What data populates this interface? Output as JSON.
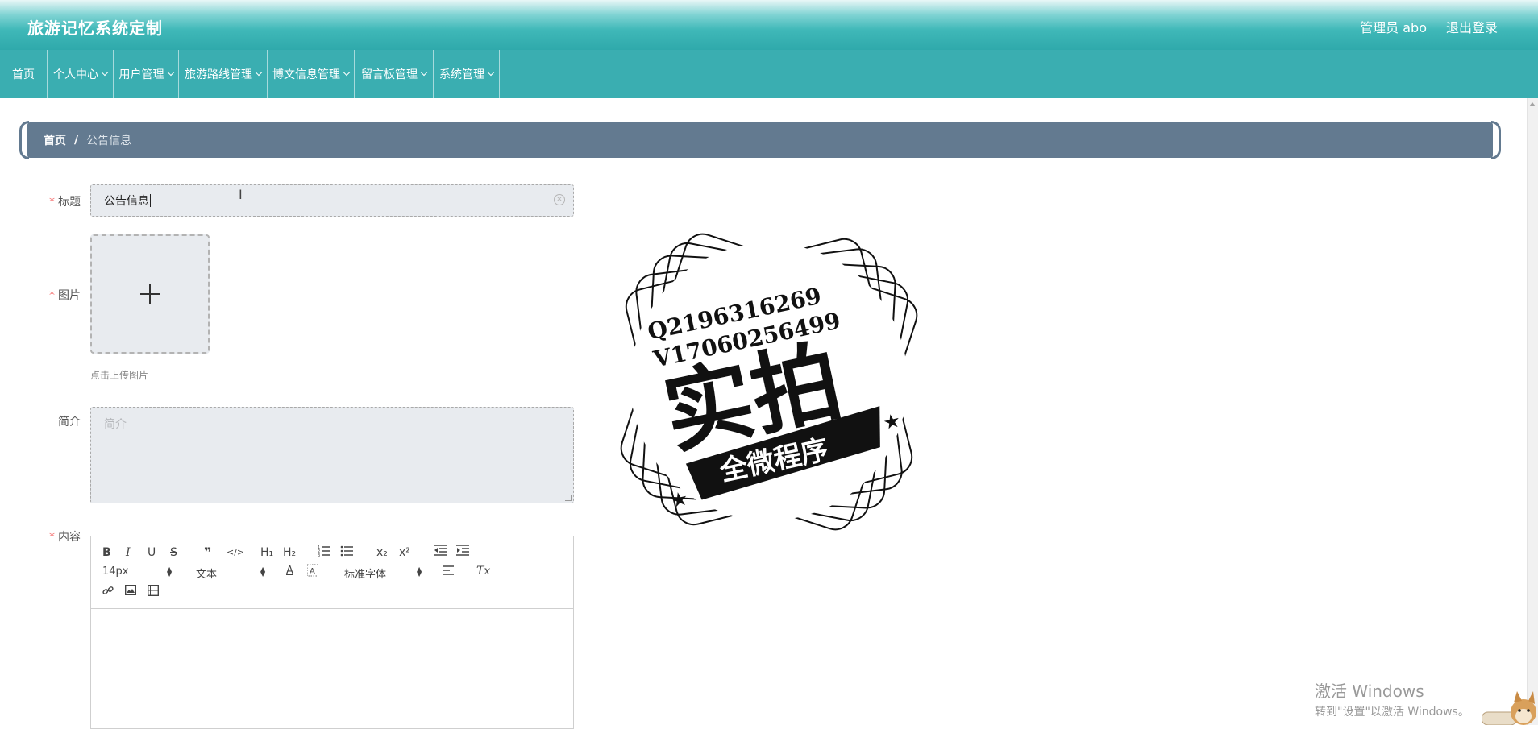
{
  "header": {
    "app_title": "旅游记忆系统定制",
    "admin_label": "管理员 abo",
    "logout_label": "退出登录"
  },
  "nav": {
    "items": [
      {
        "label": "首页",
        "has_dropdown": false
      },
      {
        "label": "个人中心",
        "has_dropdown": true
      },
      {
        "label": "用户管理",
        "has_dropdown": true
      },
      {
        "label": "旅游路线管理",
        "has_dropdown": true
      },
      {
        "label": "博文信息管理",
        "has_dropdown": true
      },
      {
        "label": "留言板管理",
        "has_dropdown": true
      },
      {
        "label": "系统管理",
        "has_dropdown": true
      }
    ]
  },
  "breadcrumb": {
    "home": "首页",
    "separator": "/",
    "current": "公告信息"
  },
  "form": {
    "title_label": "标题",
    "title_value": "公告信息",
    "image_label": "图片",
    "upload_tip": "点击上传图片",
    "intro_label": "简介",
    "intro_placeholder": "简介",
    "content_label": "内容",
    "required_mark": "*"
  },
  "editor": {
    "font_size": "14px",
    "header_select": "文本",
    "font_family": "标准字体",
    "buttons": [
      "bold",
      "italic",
      "underline",
      "strike",
      "blockquote",
      "code-block",
      "h1",
      "h2",
      "ordered-list",
      "bullet-list",
      "subscript",
      "superscript",
      "outdent",
      "indent",
      "color",
      "background",
      "align",
      "clean",
      "link",
      "image",
      "video"
    ],
    "glyphs": {
      "bold": "B",
      "italic": "I",
      "underline": "U",
      "strike": "S",
      "blockquote": "❞",
      "code": "</>",
      "h1": "H₁",
      "h2": "H₂",
      "sub": "x₂",
      "sup": "x²",
      "color": "A",
      "clean": "Tx"
    }
  },
  "watermark": {
    "line1": "Q2196316269",
    "line2": "V17060256499",
    "big": "实拍",
    "banner": "全微程序"
  },
  "windows_activation": {
    "line1": "激活 Windows",
    "line2": "转到\"设置\"以激活 Windows。"
  },
  "colors": {
    "header_teal": "#3fb8b8",
    "nav_teal": "#3aaeb1",
    "breadcrumb_bg": "#637a90",
    "required": "#f56c6c",
    "input_bg": "#e8ebef"
  }
}
